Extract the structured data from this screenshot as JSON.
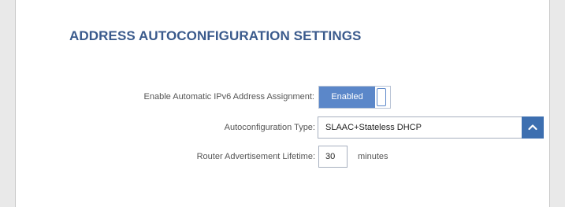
{
  "section": {
    "title": "ADDRESS AUTOCONFIGURATION SETTINGS"
  },
  "fields": {
    "auto_ipv6": {
      "label": "Enable Automatic IPv6 Address Assignment:",
      "state": "Enabled"
    },
    "autoconfig_type": {
      "label": "Autoconfiguration Type:",
      "value": "SLAAC+Stateless DHCP",
      "icon": "chevron-up-icon"
    },
    "ra_lifetime": {
      "label": "Router Advertisement Lifetime:",
      "value": "30",
      "unit": "minutes"
    }
  },
  "colors": {
    "title": "#3a5a8c",
    "accent": "#5b87c9",
    "select_button": "#3d6fb0"
  }
}
